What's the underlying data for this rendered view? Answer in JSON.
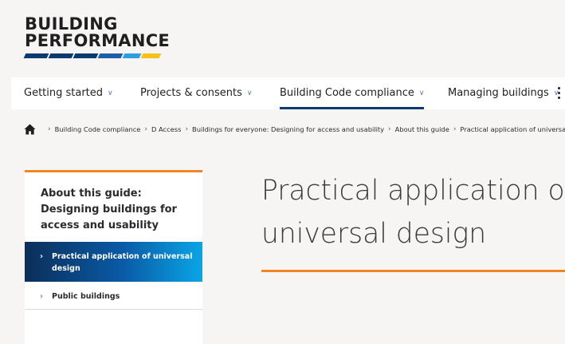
{
  "logo": {
    "line1": "BUILDING",
    "line2": "PERFORMANCE"
  },
  "nav": {
    "items": [
      {
        "label": "Getting started"
      },
      {
        "label": "Projects & consents"
      },
      {
        "label": "Building Code compliance"
      },
      {
        "label": "Managing buildings"
      }
    ],
    "active": "Building Code compliance"
  },
  "breadcrumb": {
    "items": [
      "Building Code compliance",
      "D Access",
      "Buildings for everyone: Designing for access and usability",
      "About this guide",
      "Practical application of universal design"
    ]
  },
  "sidenav": {
    "title": "About this guide: Designing buildings for access and usability",
    "items": [
      {
        "label": "Practical application of universal design",
        "active": true
      },
      {
        "label": "Public buildings",
        "active": false
      }
    ]
  },
  "page": {
    "title_line1": "Practical application of",
    "title_line2": "universal design"
  },
  "colors": {
    "accent_orange": "#f0861f",
    "navy": "#0b3a6f",
    "blue_bright": "#0aa5e6"
  },
  "icons": {
    "home": "home-icon",
    "chevron": "chevron-down-icon",
    "more": "more-vertical-icon"
  }
}
